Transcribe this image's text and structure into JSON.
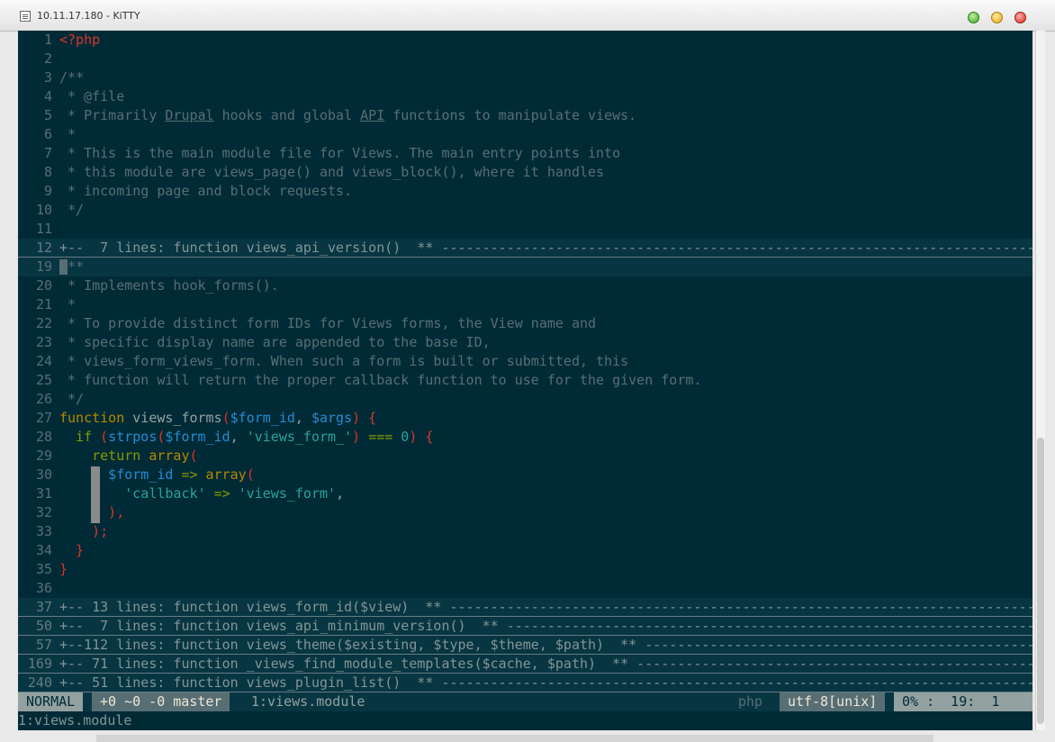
{
  "window": {
    "title": "10.11.17.180 - KiTTY"
  },
  "lines": [
    {
      "n": "1",
      "text": "<?php",
      "cls": "red"
    },
    {
      "n": "2",
      "text": ""
    },
    {
      "n": "3",
      "text": "/**",
      "cls": "comment"
    },
    {
      "n": "4",
      "text": " * @file",
      "cls": "comment"
    },
    {
      "n": "5",
      "parts": [
        {
          "t": " * Primarily ",
          "c": "comment"
        },
        {
          "t": "Drupal",
          "c": "comment ul"
        },
        {
          "t": " hooks and global ",
          "c": "comment"
        },
        {
          "t": "API",
          "c": "comment ul"
        },
        {
          "t": " functions to manipulate views.",
          "c": "comment"
        }
      ]
    },
    {
      "n": "6",
      "text": " *",
      "cls": "comment"
    },
    {
      "n": "7",
      "text": " * This is the main module file for Views. The main entry points into",
      "cls": "comment"
    },
    {
      "n": "8",
      "text": " * this module are views_page() and views_block(), where it handles",
      "cls": "comment"
    },
    {
      "n": "9",
      "text": " * incoming page and block requests.",
      "cls": "comment"
    },
    {
      "n": "10",
      "text": " */",
      "cls": "comment"
    },
    {
      "n": "11",
      "text": ""
    },
    {
      "n": "12",
      "fold": true,
      "text": "+--  7 lines: function views_api_version()  ** ------------------------------------------------------------------------------------"
    },
    {
      "n": "19",
      "cursor": true,
      "text": "**",
      "cls": "comment"
    },
    {
      "n": "20",
      "text": " * Implements hook_forms().",
      "cls": "comment"
    },
    {
      "n": "21",
      "text": " *",
      "cls": "comment"
    },
    {
      "n": "22",
      "text": " * To provide distinct form IDs for Views forms, the View name and",
      "cls": "comment"
    },
    {
      "n": "23",
      "text": " * specific display name are appended to the base ID,",
      "cls": "comment"
    },
    {
      "n": "24",
      "text": " * views_form_views_form. When such a form is built or submitted, this",
      "cls": "comment"
    },
    {
      "n": "25",
      "text": " * function will return the proper callback function to use for the given form.",
      "cls": "comment"
    },
    {
      "n": "26",
      "text": " */",
      "cls": "comment"
    },
    {
      "n": "27",
      "parts": [
        {
          "t": "function ",
          "c": "fn"
        },
        {
          "t": "views_forms",
          "c": "plain"
        },
        {
          "t": "(",
          "c": "red"
        },
        {
          "t": "$form_id",
          "c": "var"
        },
        {
          "t": ", ",
          "c": "plain"
        },
        {
          "t": "$args",
          "c": "var"
        },
        {
          "t": ") {",
          "c": "red"
        }
      ]
    },
    {
      "n": "28",
      "parts": [
        {
          "t": "  if ",
          "c": "kw"
        },
        {
          "t": "(",
          "c": "red"
        },
        {
          "t": "strpos",
          "c": "var"
        },
        {
          "t": "(",
          "c": "red"
        },
        {
          "t": "$form_id",
          "c": "var"
        },
        {
          "t": ", ",
          "c": "plain"
        },
        {
          "t": "'views_form_'",
          "c": "str"
        },
        {
          "t": ") ",
          "c": "red"
        },
        {
          "t": "===",
          "c": "op"
        },
        {
          "t": " 0",
          "c": "str"
        },
        {
          "t": ") {",
          "c": "red"
        }
      ]
    },
    {
      "n": "29",
      "parts": [
        {
          "t": "    return ",
          "c": "kw"
        },
        {
          "t": "array",
          "c": "fn"
        },
        {
          "t": "(",
          "c": "red"
        }
      ]
    },
    {
      "n": "30",
      "parts": [
        {
          "t": "      $form_id ",
          "c": "var"
        },
        {
          "t": "=>",
          "c": "op"
        },
        {
          "t": " array",
          "c": "fn"
        },
        {
          "t": "(",
          "c": "red"
        }
      ]
    },
    {
      "n": "31",
      "parts": [
        {
          "t": "        'callback'",
          "c": "str"
        },
        {
          "t": " => ",
          "c": "op"
        },
        {
          "t": "'views_form'",
          "c": "str"
        },
        {
          "t": ",",
          "c": "plain"
        }
      ]
    },
    {
      "n": "32",
      "parts": [
        {
          "t": "      ),",
          "c": "red"
        }
      ]
    },
    {
      "n": "33",
      "parts": [
        {
          "t": "    );",
          "c": "red"
        }
      ]
    },
    {
      "n": "34",
      "parts": [
        {
          "t": "  }",
          "c": "red"
        }
      ]
    },
    {
      "n": "35",
      "parts": [
        {
          "t": "}",
          "c": "red"
        }
      ]
    },
    {
      "n": "36",
      "text": ""
    },
    {
      "n": "37",
      "fold": true,
      "text": "+-- 13 lines: function views_form_id($view)  ** -----------------------------------------------------------------------------------"
    },
    {
      "n": "50",
      "fold": true,
      "text": "+--  7 lines: function views_api_minimum_version()  ** ----------------------------------------------------------------------------"
    },
    {
      "n": "57",
      "fold": true,
      "text": "+--112 lines: function views_theme($existing, $type, $theme, $path)  ** -----------------------------------------------------------"
    },
    {
      "n": "169",
      "fold": true,
      "text": "+-- 71 lines: function _views_find_module_templates($cache, $path)  ** ------------------------------------------------------------"
    },
    {
      "n": "240",
      "fold": true,
      "text": "+-- 51 lines: function views_plugin_list()  ** ------------------------------------------------------------------------------------"
    }
  ],
  "status": {
    "mode": "NORMAL",
    "git": "+0 ~0 -0 master",
    "file": "1:views.module",
    "filetype": "php",
    "encoding": "utf-8[unix]",
    "position": "0% :  19:  1"
  },
  "cmdline": "1:views.module"
}
